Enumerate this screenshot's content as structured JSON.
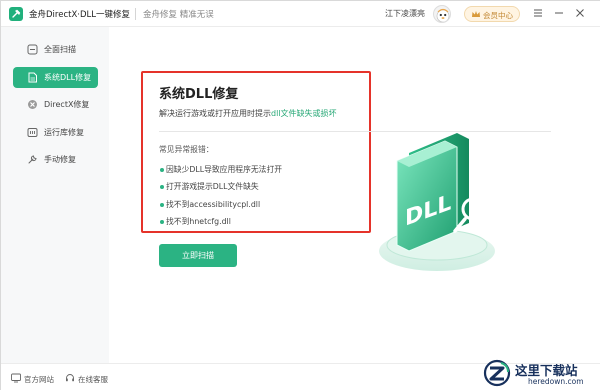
{
  "titlebar": {
    "app_title": "金舟DirectX·DLL一键修复",
    "subtitle": "金舟修复 精准无误",
    "username": "江下凌漂亮",
    "member_label": "会员中心"
  },
  "sidebar": {
    "items": [
      {
        "label": "全面扫描",
        "icon": "scan-icon",
        "active": false
      },
      {
        "label": "系统DLL修复",
        "icon": "dll-file-icon",
        "active": true
      },
      {
        "label": "DirectX修复",
        "icon": "directx-icon",
        "active": false
      },
      {
        "label": "运行库修复",
        "icon": "runtime-icon",
        "active": false
      },
      {
        "label": "手动修复",
        "icon": "wrench-icon",
        "active": false
      }
    ]
  },
  "main": {
    "title": "系统DLL修复",
    "description_prefix": "解决运行游戏或打开应用时提示",
    "description_highlight": "dll文件缺失或损坏",
    "issues_heading": "常见异常报错：",
    "issues": [
      "因缺少DLL导致应用程序无法打开",
      "打开游戏提示DLL文件缺失",
      "找不到accessibilitycpl.dll",
      "找不到hnetcfg.dll"
    ],
    "scan_button": "立即扫描",
    "illustration_text": "DLL"
  },
  "footer": {
    "website": "官方网站",
    "support": "在线客服"
  },
  "watermark": {
    "title": "这里下载站",
    "url": "heredown.com"
  },
  "colors": {
    "accent": "#2bb383",
    "highlight_text": "#28a877",
    "annotation_box": "#e5332a",
    "member_gold": "#c0852f"
  }
}
